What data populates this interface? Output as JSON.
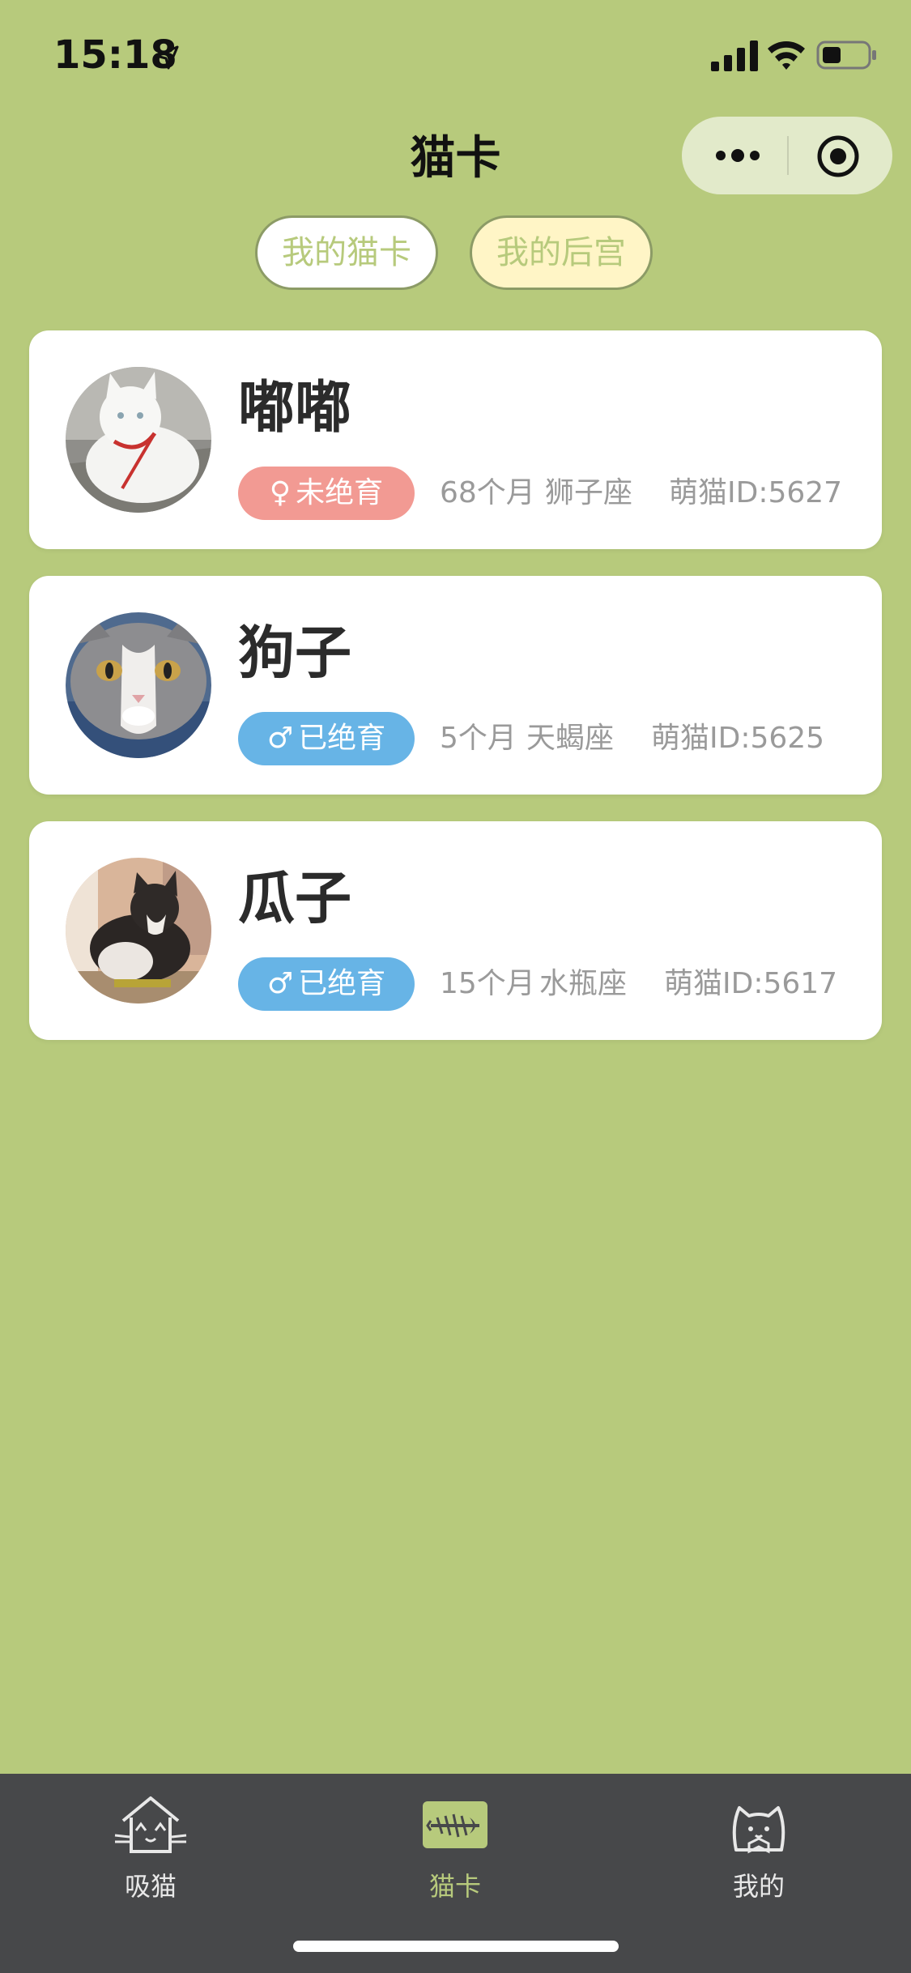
{
  "status_bar": {
    "time": "15:18",
    "icons": [
      "location-arrow-icon",
      "signal-icon",
      "wifi-icon",
      "battery-icon"
    ]
  },
  "nav": {
    "title": "猫卡",
    "capsule_icons": [
      "more-icon",
      "close-target-icon"
    ]
  },
  "tabs": [
    {
      "label": "我的猫卡",
      "active": true
    },
    {
      "label": "我的后宫",
      "active": false
    }
  ],
  "cats": [
    {
      "name": "嘟嘟",
      "gender_symbol": "♀",
      "neuter_status": "未绝育",
      "age": "68个月",
      "zodiac": "狮子座",
      "id_text": "萌猫ID:5627"
    },
    {
      "name": "狗子",
      "gender_symbol": "♂",
      "neuter_status": "已绝育",
      "age": "5个月",
      "zodiac": "天蝎座",
      "id_text": "萌猫ID:5625"
    },
    {
      "name": "瓜子",
      "gender_symbol": "♂",
      "neuter_status": "已绝育",
      "age": "15个月",
      "zodiac": "水瓶座",
      "id_text": "萌猫ID:5617"
    }
  ],
  "tabbar": [
    {
      "label": "吸猫",
      "icon": "cat-house-icon",
      "active": false
    },
    {
      "label": "猫卡",
      "icon": "fishbone-icon",
      "active": true
    },
    {
      "label": "我的",
      "icon": "cat-face-icon",
      "active": false
    }
  ],
  "colors": {
    "background": "#b7ca7c",
    "tabbar": "#47484a",
    "badge_female": "#f29a93",
    "badge_male": "#67b4e6",
    "tab_active_bg": "#ffffff",
    "tab_inactive_bg": "#fff5c6"
  }
}
